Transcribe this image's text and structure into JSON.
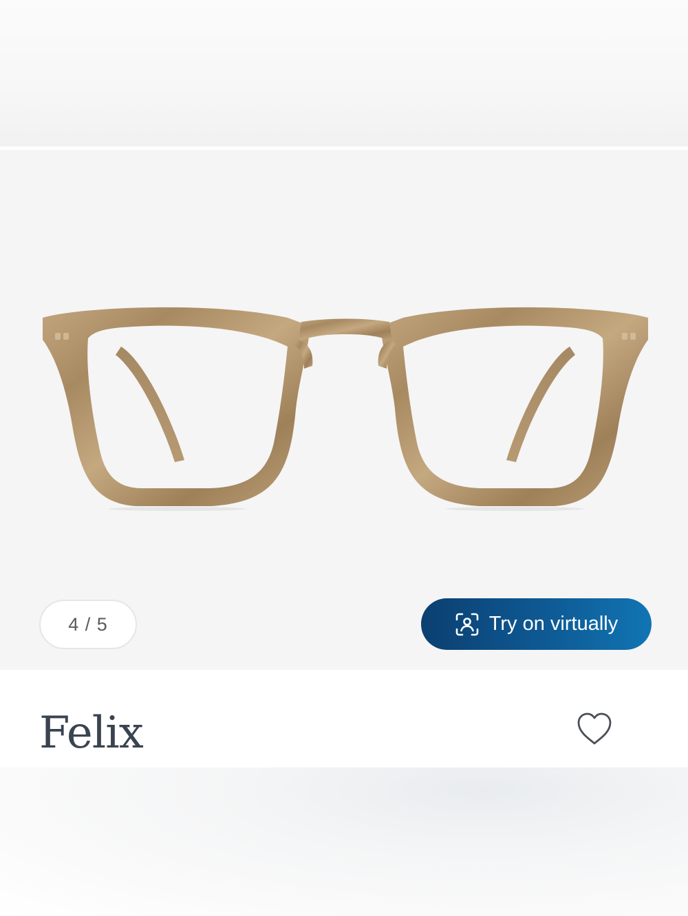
{
  "gallery": {
    "image_alt": "Felix eyeglasses front view",
    "counter": "4 / 5",
    "try_on_label": "Try on virtually",
    "try_on_icon": "face-scan-icon",
    "frame_color": "#b89a72"
  },
  "product": {
    "name": "Felix",
    "favorite_icon": "heart-icon"
  },
  "colors": {
    "accent": "#0e5a95",
    "gallery_bg": "#f5f5f5",
    "title_text": "#3a4350"
  }
}
